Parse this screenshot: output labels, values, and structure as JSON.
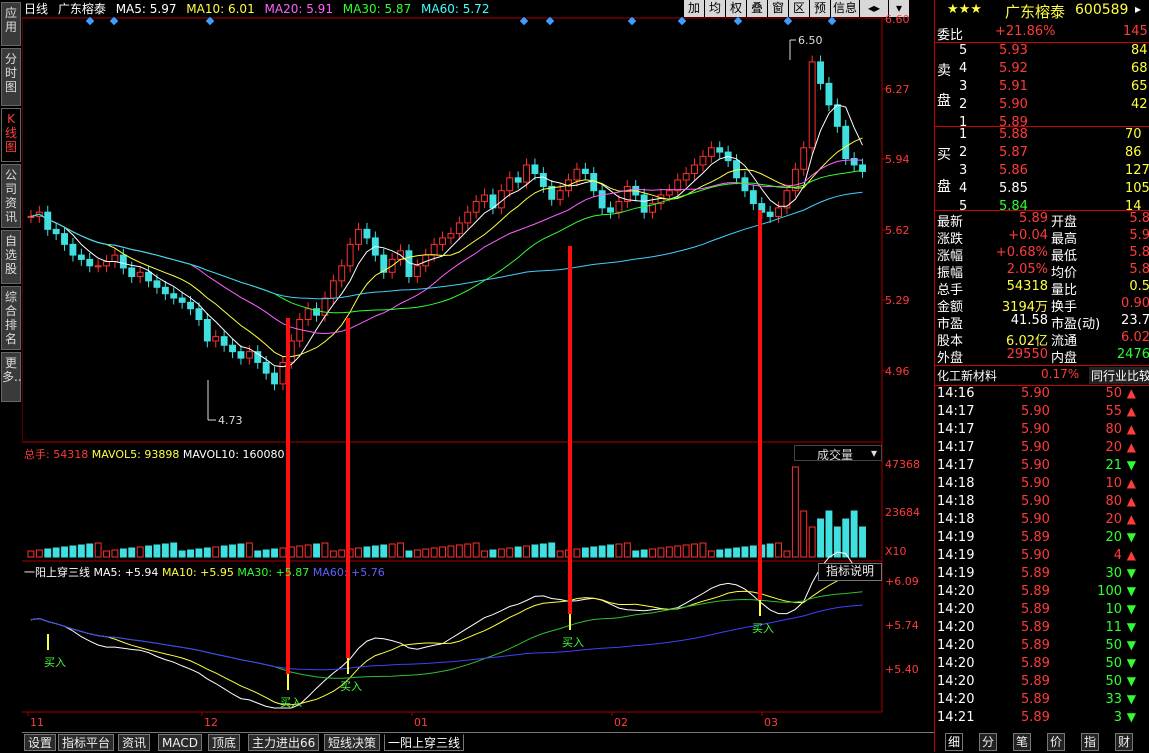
{
  "left_tabs": [
    "应用",
    "分时图",
    "K线图",
    "公司资讯",
    "自选股",
    "综合排名",
    "更多.."
  ],
  "left_tabs_active": 2,
  "header": {
    "period": "日线",
    "stock_name": "广东榕泰",
    "ma5": "MA5: 5.97",
    "ma10": "MA10: 6.01",
    "ma20": "MA20: 5.91",
    "ma30": "MA30: 5.87",
    "ma60": "MA60: 5.72"
  },
  "toolbar": [
    "加",
    "均",
    "权",
    "叠",
    "窗",
    "区",
    "预",
    "信息",
    "◂▸",
    "▾"
  ],
  "price_axis": [
    "6.60",
    "6.27",
    "5.94",
    "5.62",
    "5.29",
    "4.96"
  ],
  "annotations": {
    "high": "6.50",
    "low": "4.73"
  },
  "volume_panel": {
    "label": "总手:",
    "total": "54318",
    "mavol5": "MAVOL5: 93898",
    "mavol10": "MAVOL10: 160080",
    "selector": "成交量",
    "axis": [
      "47368",
      "23684",
      "X10"
    ]
  },
  "indicator_panel": {
    "name": "一阳上穿三线",
    "ma5": "MA5: +5.94",
    "ma10": "MA10: +5.95",
    "ma30": "MA30: +5.87",
    "ma60": "MA60: +5.76",
    "help_button": "指标说明",
    "axis": [
      "+6.09",
      "+5.74",
      "+5.40"
    ],
    "signal": "买入"
  },
  "date_axis": [
    "11",
    "12",
    "01",
    "02",
    "03"
  ],
  "bottom_tabs": [
    "设置",
    "指标平台",
    "资讯",
    "MACD",
    "顶底",
    "主力进出66",
    "短线决策",
    "一阳上穿三线"
  ],
  "bottom_tabs_active": 7,
  "quote": {
    "title_stock": "广东榕泰",
    "code": "600589",
    "wei_bi_label": "委比",
    "wei_bi": "+21.86%",
    "wei_cha": "145",
    "sell": [
      {
        "n": "5",
        "price": "5.93",
        "vol": "84"
      },
      {
        "n": "4",
        "price": "5.92",
        "vol": "68"
      },
      {
        "n": "3",
        "price": "5.91",
        "vol": "65"
      },
      {
        "n": "2",
        "price": "5.90",
        "vol": "42"
      },
      {
        "n": "1",
        "price": "5.89",
        "vol": ""
      }
    ],
    "sell_label": [
      "卖",
      "盘"
    ],
    "buy": [
      {
        "n": "1",
        "price": "5.88",
        "vol": "70"
      },
      {
        "n": "2",
        "price": "5.87",
        "vol": "86"
      },
      {
        "n": "3",
        "price": "5.86",
        "vol": "127"
      },
      {
        "n": "4",
        "price": "5.85",
        "vol": "105"
      },
      {
        "n": "5",
        "price": "5.84",
        "vol": "14"
      }
    ],
    "buy_label": [
      "买",
      "盘"
    ],
    "stats": [
      {
        "l1": "最新",
        "v1": "5.89",
        "l2": "开盘",
        "v2": "5.8"
      },
      {
        "l1": "涨跌",
        "v1": "+0.04",
        "l2": "最高",
        "v2": "5.9"
      },
      {
        "l1": "涨幅",
        "v1": "+0.68%",
        "l2": "最低",
        "v2": "5.8"
      },
      {
        "l1": "振幅",
        "v1": "2.05%",
        "l2": "均价",
        "v2": "5.8"
      },
      {
        "l1": "总手",
        "v1": "54318",
        "l2": "量比",
        "v2": "0.5"
      },
      {
        "l1": "金额",
        "v1": "3194万",
        "l2": "换手",
        "v2": "0.90"
      },
      {
        "l1": "市盈",
        "v1": "41.58",
        "l2": "市盈(动)",
        "v2": "23.7"
      },
      {
        "l1": "股本",
        "v1": "6.02亿",
        "l2": "流通",
        "v2": "6.02"
      },
      {
        "l1": "外盘",
        "v1": "29550",
        "l2": "内盘",
        "v2": "2476"
      }
    ],
    "sector": "化工新材料",
    "sector_pct": "0.17%",
    "sector_compare": "同行业比较",
    "ticks": [
      {
        "t": "14:16",
        "p": "5.90",
        "v": "50",
        "dir": "up"
      },
      {
        "t": "14:17",
        "p": "5.90",
        "v": "55",
        "dir": "up"
      },
      {
        "t": "14:17",
        "p": "5.90",
        "v": "80",
        "dir": "up"
      },
      {
        "t": "14:17",
        "p": "5.90",
        "v": "20",
        "dir": "up"
      },
      {
        "t": "14:17",
        "p": "5.90",
        "v": "21",
        "dir": "down"
      },
      {
        "t": "14:18",
        "p": "5.90",
        "v": "10",
        "dir": "up"
      },
      {
        "t": "14:18",
        "p": "5.90",
        "v": "80",
        "dir": "up"
      },
      {
        "t": "14:18",
        "p": "5.90",
        "v": "20",
        "dir": "up"
      },
      {
        "t": "14:19",
        "p": "5.89",
        "v": "20",
        "dir": "down"
      },
      {
        "t": "14:19",
        "p": "5.90",
        "v": "4",
        "dir": "up"
      },
      {
        "t": "14:19",
        "p": "5.89",
        "v": "30",
        "dir": "down"
      },
      {
        "t": "14:20",
        "p": "5.89",
        "v": "100",
        "dir": "down"
      },
      {
        "t": "14:20",
        "p": "5.89",
        "v": "10",
        "dir": "down"
      },
      {
        "t": "14:20",
        "p": "5.89",
        "v": "11",
        "dir": "down"
      },
      {
        "t": "14:20",
        "p": "5.89",
        "v": "50",
        "dir": "down"
      },
      {
        "t": "14:20",
        "p": "5.89",
        "v": "50",
        "dir": "down"
      },
      {
        "t": "14:20",
        "p": "5.89",
        "v": "50",
        "dir": "down"
      },
      {
        "t": "14:20",
        "p": "5.89",
        "v": "33",
        "dir": "down"
      },
      {
        "t": "14:21",
        "p": "5.89",
        "v": "3",
        "dir": "down"
      }
    ],
    "bottom_tabs": [
      "细",
      "分",
      "笔",
      "价",
      "指",
      "财"
    ]
  }
}
